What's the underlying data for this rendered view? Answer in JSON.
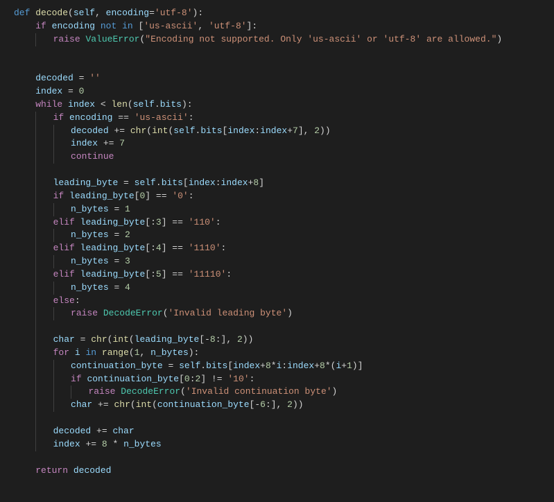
{
  "code": {
    "l1": {
      "def": "def",
      "fn": "decode",
      "self": "self",
      "param": "encoding",
      "defval": "'utf-8'"
    },
    "l2": {
      "if": "if",
      "var": "encoding",
      "not": "not",
      "in": "in",
      "list": "['us-ascii', 'utf-8']"
    },
    "l3": {
      "raise": "raise",
      "err": "ValueError",
      "msg": "\"Encoding not supported. Only 'us-ascii' or 'utf-8' are allowed.\""
    },
    "l4": {
      "var": "decoded",
      "val": "''"
    },
    "l5": {
      "var": "index",
      "val": "0"
    },
    "l6": {
      "while": "while",
      "var": "index",
      "len": "len",
      "self": "self",
      "bits": "bits"
    },
    "l7": {
      "if": "if",
      "var": "encoding",
      "val": "'us-ascii'"
    },
    "l8": {
      "var": "decoded",
      "chr": "chr",
      "int": "int",
      "self": "self",
      "bits": "bits",
      "idx": "index",
      "idx2": "index",
      "n7": "7",
      "n2": "2"
    },
    "l9": {
      "var": "index",
      "n": "7"
    },
    "l10": {
      "cont": "continue"
    },
    "l11": {
      "var": "leading_byte",
      "self": "self",
      "bits": "bits",
      "idx": "index",
      "idx2": "index",
      "n": "8"
    },
    "l12": {
      "if": "if",
      "var": "leading_byte",
      "n0": "0",
      "val": "'0'"
    },
    "l13": {
      "var": "n_bytes",
      "n": "1"
    },
    "l14": {
      "elif": "elif",
      "var": "leading_byte",
      "n": "3",
      "val": "'110'"
    },
    "l15": {
      "var": "n_bytes",
      "n": "2"
    },
    "l16": {
      "elif": "elif",
      "var": "leading_byte",
      "n": "4",
      "val": "'1110'"
    },
    "l17": {
      "var": "n_bytes",
      "n": "3"
    },
    "l18": {
      "elif": "elif",
      "var": "leading_byte",
      "n": "5",
      "val": "'11110'"
    },
    "l19": {
      "var": "n_bytes",
      "n": "4"
    },
    "l20": {
      "else": "else"
    },
    "l21": {
      "raise": "raise",
      "err": "DecodeError",
      "msg": "'Invalid leading byte'"
    },
    "l22": {
      "var": "char",
      "chr": "chr",
      "int": "int",
      "lb": "leading_byte",
      "n8": "8",
      "n2": "2"
    },
    "l23": {
      "for": "for",
      "i": "i",
      "in": "in",
      "range": "range",
      "n1": "1",
      "nb": "n_bytes"
    },
    "l24": {
      "var": "continuation_byte",
      "self": "self",
      "bits": "bits",
      "idx": "index",
      "n8a": "8",
      "i": "i",
      "idx2": "index",
      "n8b": "8",
      "i2": "i",
      "n1": "1"
    },
    "l25": {
      "if": "if",
      "var": "continuation_byte",
      "n0": "0",
      "n2": "2",
      "val": "'10'"
    },
    "l26": {
      "raise": "raise",
      "err": "DecodeError",
      "msg": "'Invalid continuation byte'"
    },
    "l27": {
      "var": "char",
      "chr": "chr",
      "int": "int",
      "cb": "continuation_byte",
      "n6": "6",
      "n2": "2"
    },
    "l28": {
      "var": "decoded",
      "char": "char"
    },
    "l29": {
      "var": "index",
      "n8": "8",
      "nb": "n_bytes"
    },
    "l30": {
      "ret": "return",
      "var": "decoded"
    }
  }
}
